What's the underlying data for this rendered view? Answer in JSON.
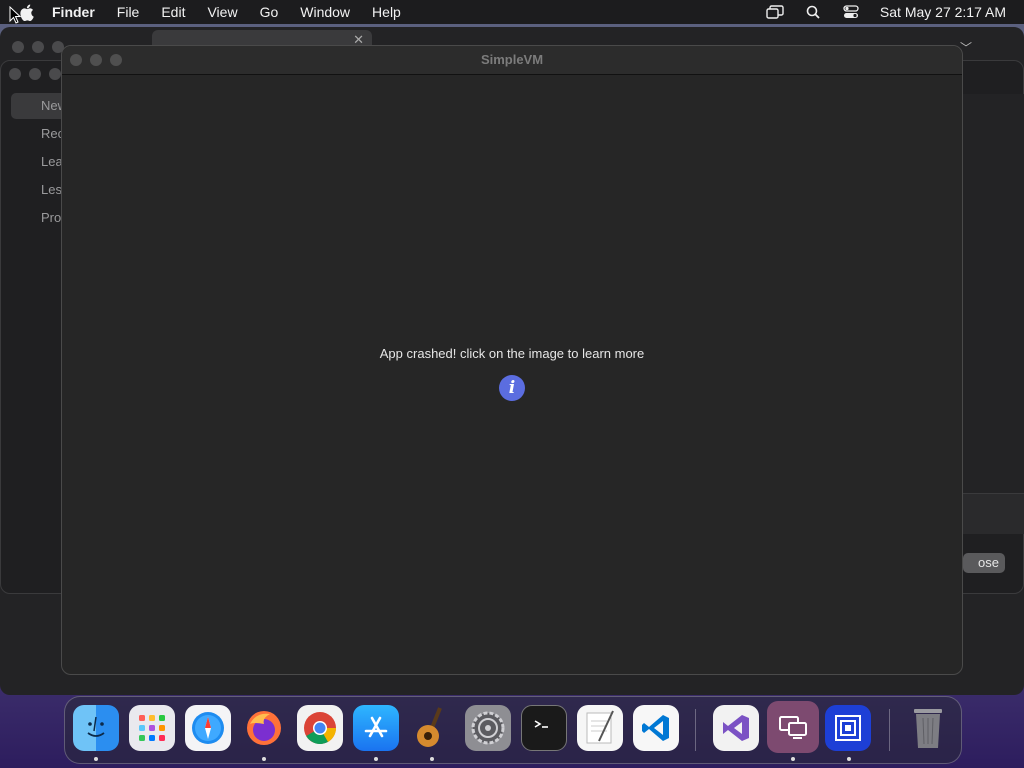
{
  "menubar": {
    "app_name": "Finder",
    "items": [
      "File",
      "Edit",
      "View",
      "Go",
      "Window",
      "Help"
    ],
    "clock": "Sat May 27  2:17 AM"
  },
  "background_window": {
    "sidebar_items": [
      "New",
      "Rec",
      "Lea",
      "Les",
      "Pro"
    ],
    "close_button_label": "ose"
  },
  "main_window": {
    "title": "SimpleVM",
    "crash_message": "App crashed! click on the image to learn more",
    "info_icon_label": "i"
  },
  "dock": {
    "apps": [
      "Finder",
      "Launchpad",
      "Safari",
      "Firefox",
      "Chrome",
      "App Store",
      "GarageBand",
      "System Preferences",
      "Terminal",
      "TextEdit",
      "Visual Studio Code",
      "Visual Studio",
      "Screen Sharing",
      "Remote Desktop",
      "Trash"
    ]
  },
  "colors": {
    "accent_info": "#5b6de0",
    "window_bg": "#262626"
  }
}
